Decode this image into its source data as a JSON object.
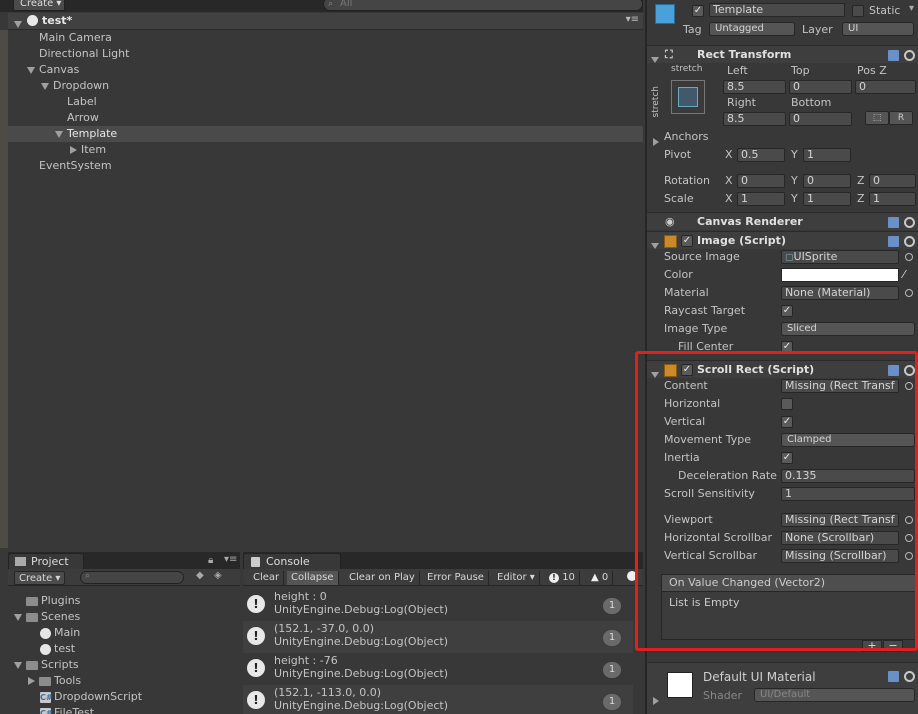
{
  "hierarchy": {
    "create_label": "Create",
    "search_placeholder": "All",
    "scene_name": "test*",
    "items": [
      {
        "label": "Main Camera"
      },
      {
        "label": "Directional Light"
      },
      {
        "label": "Canvas"
      },
      {
        "label": "Dropdown"
      },
      {
        "label": "Label"
      },
      {
        "label": "Arrow"
      },
      {
        "label": "Template"
      },
      {
        "label": "Item"
      },
      {
        "label": "EventSystem"
      }
    ]
  },
  "project": {
    "tab_label": "Project",
    "create_label": "Create",
    "items": [
      {
        "label": "Plugins"
      },
      {
        "label": "Scenes"
      },
      {
        "label": "Main"
      },
      {
        "label": "test"
      },
      {
        "label": "Scripts"
      },
      {
        "label": "Tools"
      },
      {
        "label": "DropdownScript"
      },
      {
        "label": "FileTest"
      }
    ]
  },
  "console": {
    "tab_label": "Console",
    "buttons": {
      "clear": "Clear",
      "collapse": "Collapse",
      "clear_on_play": "Clear on Play",
      "error_pause": "Error Pause",
      "editor": "Editor"
    },
    "log_count": "10",
    "warn_count": "0",
    "entries": [
      {
        "line1": "height : 0",
        "line2": "UnityEngine.Debug:Log(Object)",
        "count": "1"
      },
      {
        "line1": "(152.1, -37.0, 0.0)",
        "line2": "UnityEngine.Debug:Log(Object)",
        "count": "1"
      },
      {
        "line1": "height : -76",
        "line2": "UnityEngine.Debug:Log(Object)",
        "count": "1"
      },
      {
        "line1": "(152.1, -113.0, 0.0)",
        "line2": "UnityEngine.Debug:Log(Object)",
        "count": "1"
      }
    ]
  },
  "inspector": {
    "object_name": "Template",
    "static_label": "Static",
    "tag_label": "Tag",
    "tag_value": "Untagged",
    "layer_label": "Layer",
    "layer_value": "UI",
    "rect_transform": {
      "title": "Rect Transform",
      "stretch_h": "stretch",
      "stretch_v": "stretch",
      "left_label": "Left",
      "top_label": "Top",
      "posz_label": "Pos Z",
      "left": "8.5",
      "top": "0",
      "posz": "0",
      "right_label": "Right",
      "bottom_label": "Bottom",
      "right": "8.5",
      "bottom": "0",
      "r_button": "R",
      "anchors_label": "Anchors",
      "pivot_label": "Pivot",
      "pivot_x": "0.5",
      "pivot_y": "1",
      "rotation_label": "Rotation",
      "rot_x": "0",
      "rot_y": "0",
      "rot_z": "0",
      "scale_label": "Scale",
      "scale_x": "1",
      "scale_y": "1",
      "scale_z": "1",
      "x": "X",
      "y": "Y",
      "z": "Z"
    },
    "canvas_renderer": {
      "title": "Canvas Renderer"
    },
    "image": {
      "title": "Image (Script)",
      "source_image_label": "Source Image",
      "source_image": "UISprite",
      "color_label": "Color",
      "material_label": "Material",
      "material": "None (Material)",
      "raycast_label": "Raycast Target",
      "image_type_label": "Image Type",
      "image_type": "Sliced",
      "fill_center_label": "Fill Center"
    },
    "scroll_rect": {
      "title": "Scroll Rect (Script)",
      "content_label": "Content",
      "content": "Missing (Rect Transf",
      "horizontal_label": "Horizontal",
      "vertical_label": "Vertical",
      "movement_type_label": "Movement Type",
      "movement_type": "Clamped",
      "inertia_label": "Inertia",
      "deceleration_label": "Deceleration Rate",
      "deceleration": "0.135",
      "sensitivity_label": "Scroll Sensitivity",
      "sensitivity": "1",
      "viewport_label": "Viewport",
      "viewport": "Missing (Rect Transf",
      "hscroll_label": "Horizontal Scrollbar",
      "hscroll": "None (Scrollbar)",
      "vscroll_label": "Vertical Scrollbar",
      "vscroll": "Missing (Scrollbar)",
      "event_title": "On Value Changed (Vector2)",
      "event_body": "List is Empty",
      "plus": "+",
      "minus": "−"
    },
    "material": {
      "name": "Default UI Material",
      "shader_label": "Shader",
      "shader": "UI/Default"
    }
  }
}
